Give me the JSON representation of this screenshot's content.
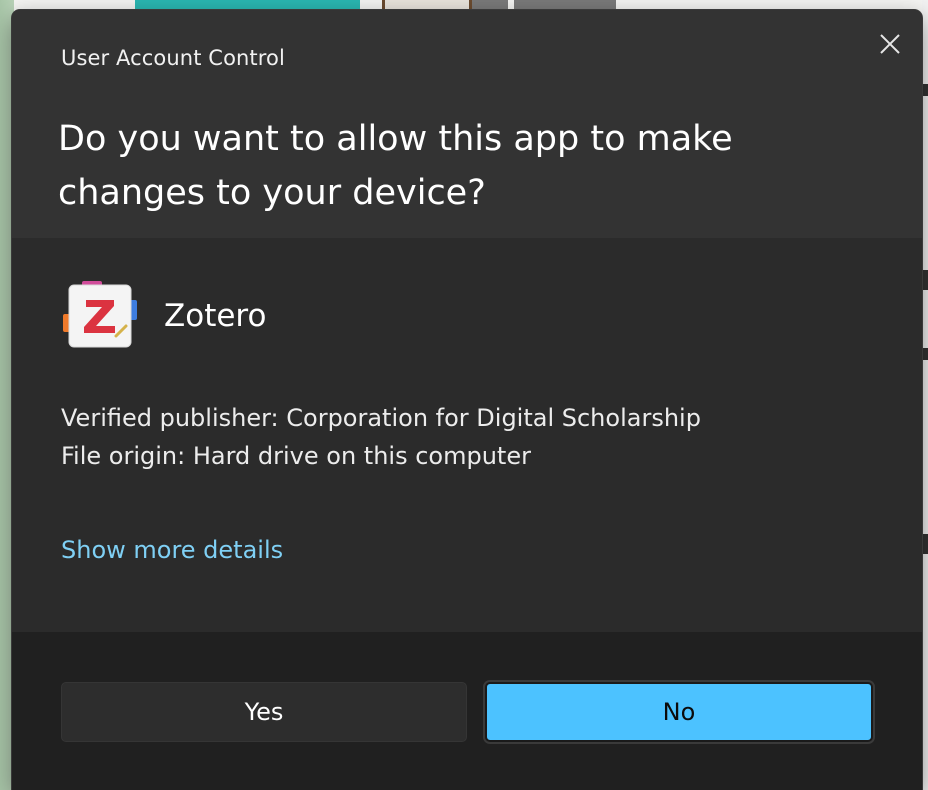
{
  "dialog": {
    "title": "User Account Control",
    "question": "Do you want to allow this app to make changes to your device?",
    "app": {
      "name": "Zotero",
      "icon": "zotero-logo-icon"
    },
    "publisher_line": "Verified publisher: Corporation for Digital Scholarship",
    "origin_line": "File origin: Hard drive on this computer",
    "details_link": "Show more details",
    "buttons": {
      "yes": "Yes",
      "no": "No"
    },
    "close_icon": "close-icon"
  },
  "colors": {
    "dialog_header": "#333333",
    "dialog_body": "#2b2b2b",
    "dialog_footer": "#202020",
    "accent": "#4cc2ff",
    "link": "#7fd0f5"
  }
}
